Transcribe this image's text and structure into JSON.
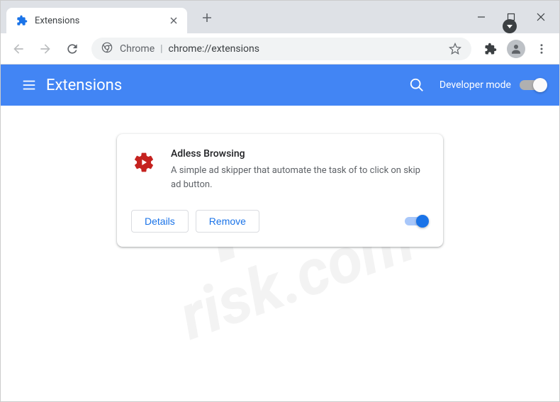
{
  "tab": {
    "title": "Extensions"
  },
  "omnibox": {
    "label": "Chrome",
    "url": "chrome://extensions"
  },
  "page": {
    "title": "Extensions",
    "dev_mode_label": "Developer mode"
  },
  "extension": {
    "name": "Adless Browsing",
    "description": "A simple ad skipper that automate the task of to click on skip ad button.",
    "details_label": "Details",
    "remove_label": "Remove"
  },
  "watermark": {
    "line1": "PC",
    "line2": "risk.com"
  }
}
